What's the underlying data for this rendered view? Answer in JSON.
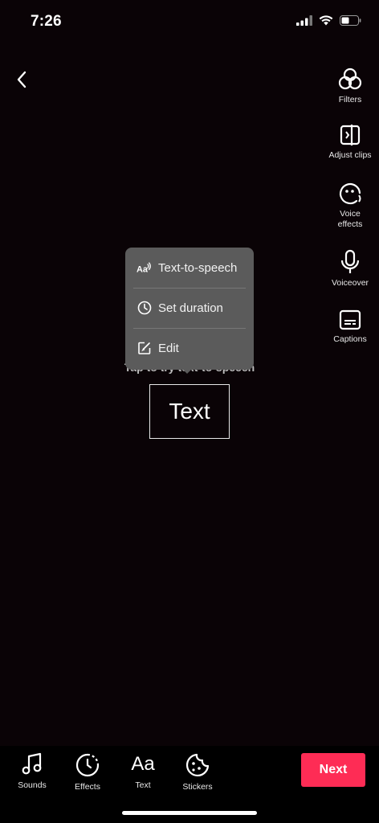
{
  "status_bar": {
    "time": "7:26"
  },
  "right_tools": [
    {
      "label": "Filters",
      "icon": "filters-icon"
    },
    {
      "label": "Adjust clips",
      "icon": "adjust-clips-icon"
    },
    {
      "label": "Voice effects",
      "icon": "voice-effects-icon"
    },
    {
      "label": "Voiceover",
      "icon": "microphone-icon"
    },
    {
      "label": "Captions",
      "icon": "captions-icon"
    }
  ],
  "menu": {
    "items": [
      {
        "label": "Text-to-speech",
        "icon": "text-to-speech-icon"
      },
      {
        "label": "Set duration",
        "icon": "clock-icon"
      },
      {
        "label": "Edit",
        "icon": "edit-icon"
      }
    ]
  },
  "hint": "Tap to try text-to-speech",
  "text_box": {
    "text": "Text"
  },
  "bottom_tools": [
    {
      "label": "Sounds",
      "icon": "music-note-icon"
    },
    {
      "label": "Effects",
      "icon": "effects-icon"
    },
    {
      "label": "Text",
      "icon": "text-aa-icon",
      "glyph": "Aa"
    },
    {
      "label": "Stickers",
      "icon": "sticker-icon"
    }
  ],
  "next_button": {
    "label": "Next"
  },
  "colors": {
    "accent": "#fe2c55",
    "menu_bg": "#5b5b5b",
    "background": "#0a0306"
  }
}
